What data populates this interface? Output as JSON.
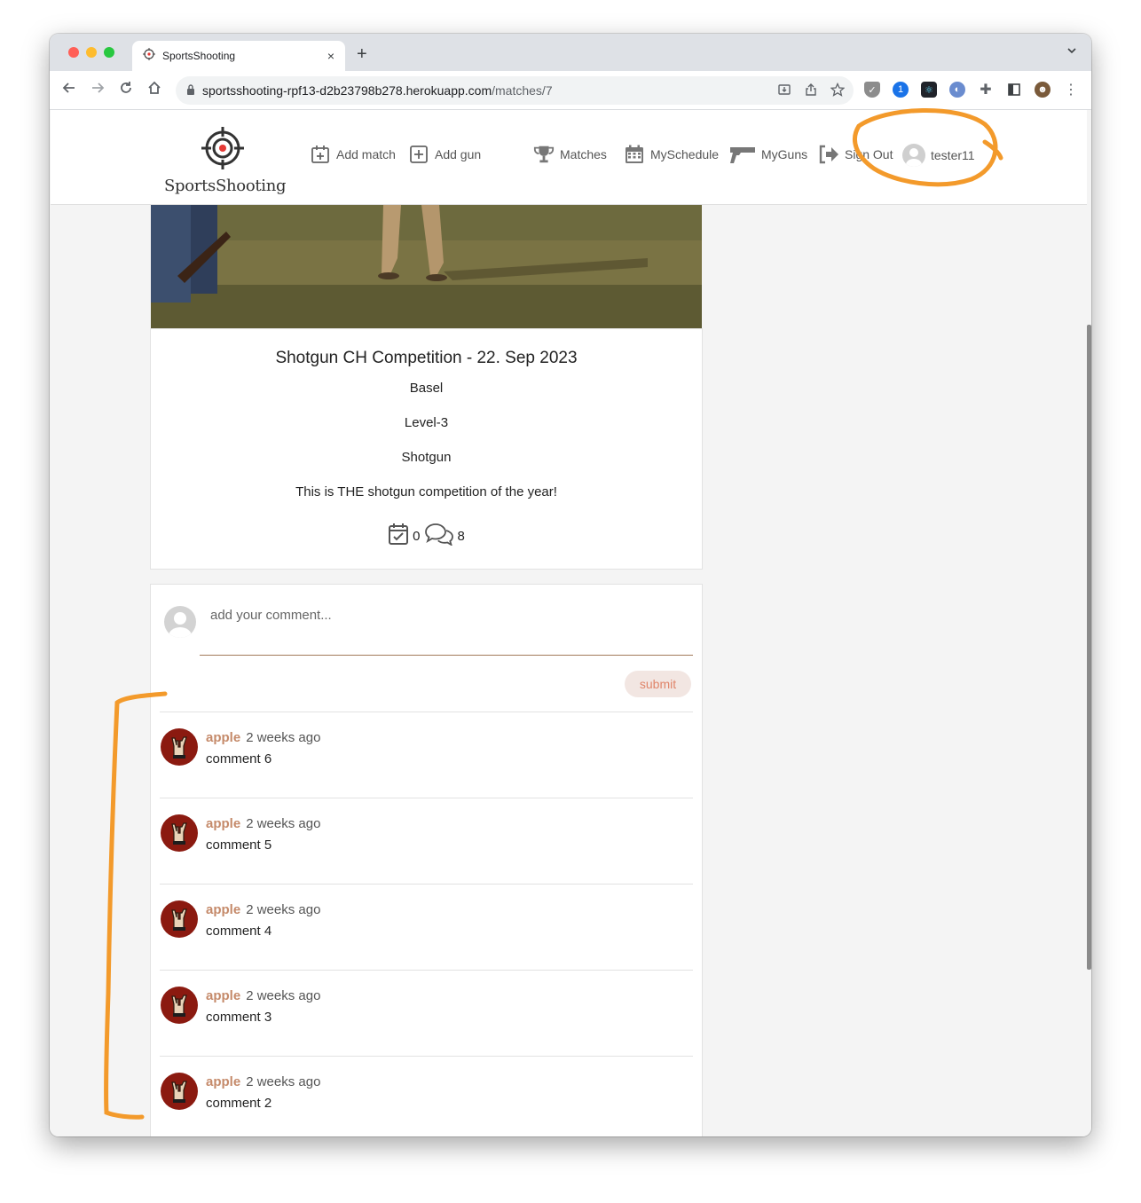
{
  "browser": {
    "tab_title": "SportsShooting",
    "tab_close": "×",
    "new_tab": "+",
    "url_host": "sportsshooting-rpf13-d2b23798b278.herokuapp.com",
    "url_path": "/matches/7"
  },
  "nav": {
    "logo_text": "SportsShooting",
    "add_match": "Add match",
    "add_gun": "Add gun",
    "matches": "Matches",
    "my_schedule": "MySchedule",
    "my_guns": "MyGuns",
    "sign_out": "Sign Out",
    "username": "tester11"
  },
  "match": {
    "title": "Shotgun CH Competition - 22. Sep 2023",
    "location": "Basel",
    "level": "Level-3",
    "category": "Shotgun",
    "description": "This is THE shotgun competition of the year!",
    "schedule_count": "0",
    "comment_count": "8"
  },
  "comment_form": {
    "placeholder": "add your comment...",
    "submit_label": "submit"
  },
  "comments": [
    {
      "author": "apple",
      "time": "2 weeks ago",
      "text": "comment 6"
    },
    {
      "author": "apple",
      "time": "2 weeks ago",
      "text": "comment 5"
    },
    {
      "author": "apple",
      "time": "2 weeks ago",
      "text": "comment 4"
    },
    {
      "author": "apple",
      "time": "2 weeks ago",
      "text": "comment 3"
    },
    {
      "author": "apple",
      "time": "2 weeks ago",
      "text": "comment 2"
    }
  ],
  "colors": {
    "accent": "#c58a6a",
    "submit_text": "#e0856a",
    "annotation": "#f39a2b"
  }
}
